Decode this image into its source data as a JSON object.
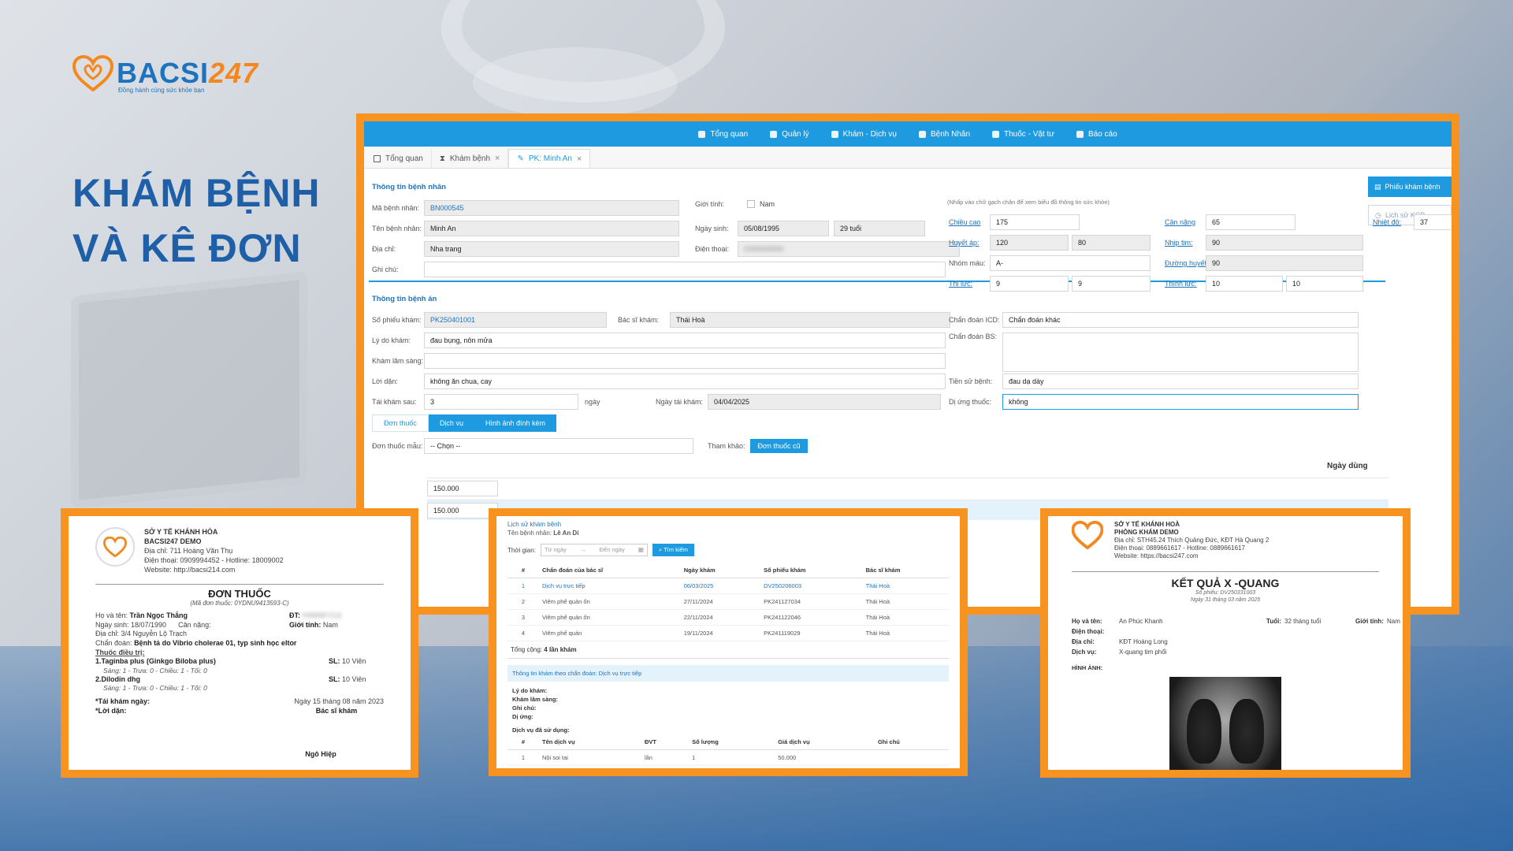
{
  "brand": {
    "name_a": "BACSI",
    "name_b": "247",
    "tagline": "Đồng hành cùng sức khỏe bạn"
  },
  "headline": {
    "line1": "KHÁM BỆNH",
    "line2": "VÀ KÊ ĐƠN"
  },
  "colors": {
    "accent": "#1e9ae0",
    "frame": "#f7931e",
    "title": "#1f5fa8"
  },
  "app": {
    "nav": [
      {
        "label": "Tổng quan",
        "icon": "dashboard-icon"
      },
      {
        "label": "Quản lý",
        "icon": "users-icon"
      },
      {
        "label": "Khám - Dịch vụ",
        "icon": "doctor-icon"
      },
      {
        "label": "Bệnh Nhân",
        "icon": "patient-icon"
      },
      {
        "label": "Thuốc - Vật tư",
        "icon": "medicine-icon"
      },
      {
        "label": "Báo cáo",
        "icon": "report-icon"
      }
    ],
    "tabs": [
      {
        "label": "Tổng quan"
      },
      {
        "label": "Khám bệnh"
      },
      {
        "label": "PK: Minh An"
      }
    ],
    "side": {
      "primary": "Phiếu khám bệnh",
      "secondary": "Lịch sử KCB"
    },
    "patient": {
      "title": "Thông tin bệnh nhân",
      "hint": "(Nhấp vào chữ gạch chân để xem biểu đồ thông tin sức khỏe)",
      "ma_bn_label": "Mã bệnh nhân:",
      "ma_bn": "BN000545",
      "gioi_tinh_label": "Giới tính:",
      "gioi_tinh": "Nam",
      "ten_label": "Tên bệnh nhân:",
      "ten": "Minh An",
      "ngay_sinh_label": "Ngày sinh:",
      "ngay_sinh": "05/08/1995",
      "tuoi": "29 tuổi",
      "dia_chi_label": "Địa chỉ:",
      "dia_chi": "Nha trang",
      "dien_thoai_label": "Điện thoại:",
      "dien_thoai": "0988888888",
      "ghi_chu_label": "Ghi chú:",
      "chieu_cao_label": "Chiều cao",
      "chieu_cao": "175",
      "can_nang_label": "Cân nặng",
      "can_nang": "65",
      "nhiet_do_label": "Nhiệt độ:",
      "nhiet_do": "37",
      "huyet_ap_label": "Huyết áp:",
      "huyet_ap_1": "120",
      "huyet_ap_2": "80",
      "nhip_tim_label": "Nhịp tim:",
      "nhip_tim": "90",
      "nhom_mau_label": "Nhóm máu:",
      "nhom_mau": "A-",
      "duong_huyet_label": "Đường huyết",
      "duong_huyet": "90",
      "thi_luc_label": "Thị lực:",
      "thi_luc_1": "9",
      "thi_luc_2": "9",
      "thinh_luc_label": "Thính lực:",
      "thinh_luc_1": "10",
      "thinh_luc_2": "10"
    },
    "record": {
      "title": "Thông tin bệnh án",
      "so_phieu_label": "Số phiếu khám:",
      "so_phieu": "PK250401001",
      "bac_si_label": "Bác sĩ khám:",
      "bac_si": "Thái Hoà",
      "icd_label": "Chẩn đoán ICD:",
      "icd": "Chẩn đoán khác",
      "ly_do_label": "Lý do khám:",
      "ly_do": "đau bụng, nôn mửa",
      "chan_doan_bs_label": "Chẩn đoán BS:",
      "kham_ls_label": "Khám lâm sàng:",
      "loi_dan_label": "Lời dặn:",
      "loi_dan": "không ăn chua, cay",
      "tien_su_label": "Tiền sử bệnh:",
      "tien_su": "đau dạ dày",
      "tai_kham_label": "Tái khám sau:",
      "tai_kham": "3",
      "tai_kham_unit": "ngày",
      "ngay_tai_kham_label": "Ngày tái khám:",
      "ngay_tai_kham": "04/04/2025",
      "di_ung_label": "Dị ứng thuốc:",
      "di_ung": "không"
    },
    "subtabs": [
      "Đơn thuốc",
      "Dịch vụ",
      "Hình ảnh đính kèm"
    ],
    "don_mau_label": "Đơn thuốc mẫu:",
    "don_mau": "-- Chọn --",
    "tham_khao_label": "Tham khảo:",
    "don_cu_btn": "Đơn thuốc cũ",
    "col_ngay_dung": "Ngày dùng",
    "grid_values": [
      "150.000",
      "150.000"
    ]
  },
  "prescription": {
    "org1": "SỞ Y TẾ KHÁNH HÒA",
    "org2": "BACSI247 DEMO",
    "address": "Địa chỉ: 711 Hoàng Văn Thụ",
    "phone": "Điện thoại: 0909994452 - Hotline: 18009002",
    "website": "Website: http://bacsi214.com",
    "title": "ĐƠN THUỐC",
    "code": "(Mã đơn thuốc: 0YDNU9413593-C)",
    "ho_ten_label": "Họ và tên:",
    "ho_ten": "Trần Ngọc Thắng",
    "dt_label": "ĐT:",
    "dt": "0988887216",
    "ngay_sinh": "Ngày sinh: 18/07/1990",
    "can_nang": "Cân nặng:",
    "gioi_tinh_label": "Giới tính:",
    "gioi_tinh": "Nam",
    "dia_chi": "Địa chỉ: 3/4 Nguyễn Lộ Trạch",
    "chan_doan_label": "Chẩn đoán:",
    "chan_doan": "Bệnh tả do Vibrio cholerae 01, typ sinh học eltor",
    "thuoc_label": "Thuốc điều trị:",
    "drugs": [
      {
        "name": "1.Taginba plus (Ginkgo Biloba plus)",
        "qty_label": "SL:",
        "qty": "10 Viên",
        "dose": "Sáng: 1 - Trưa: 0 - Chiều: 1 - Tối: 0"
      },
      {
        "name": "2.Dilodin dhg",
        "qty_label": "SL:",
        "qty": "10 Viên",
        "dose": "Sáng: 1 - Trưa: 0 - Chiều: 1 - Tối: 0"
      }
    ],
    "tai_kham_label": "*Tái khám ngày:",
    "date": "Ngày 15 tháng 08 năm 2023",
    "loi_dan_label": "*Lời dặn:",
    "bac_si_label": "Bác sĩ khám",
    "signer": "Ngô Hiệp"
  },
  "history": {
    "title": "Lịch sử khám bệnh",
    "patient_label": "Tên bệnh nhân:",
    "patient": "Lê An Di",
    "time_label": "Thời gian:",
    "from_ph": "Từ ngày",
    "to_ph": "Đến ngày",
    "search_btn": "Tìm kiếm",
    "columns": [
      "#",
      "Chẩn đoán của bác sĩ",
      "Ngày khám",
      "Số phiếu khám",
      "Bác sĩ khám"
    ],
    "rows": [
      {
        "n": "1",
        "dx": "Dịch vụ trực tiếp",
        "date": "06/03/2025",
        "code": "DV250206003",
        "doc": "Thái Hoà"
      },
      {
        "n": "2",
        "dx": "Viêm phế quản ốn",
        "date": "27/11/2024",
        "code": "PK241127034",
        "doc": "Thái Hoà"
      },
      {
        "n": "3",
        "dx": "Viêm phế quản ốn",
        "date": "22/11/2024",
        "code": "PK241122046",
        "doc": "Thái Hoà"
      },
      {
        "n": "4",
        "dx": "Viêm phế quản",
        "date": "19/11/2024",
        "code": "PK241119029",
        "doc": "Thái Hoà"
      }
    ],
    "total_label": "Tổng cộng:",
    "total": "4 lần khám",
    "band": "Thông tin khám theo chẩn đoán: Dịch vụ trực tiếp",
    "kv": [
      "Lý do khám:",
      "Khám lâm sàng:",
      "Ghi chú:",
      "Dị ứng:"
    ],
    "dv_label": "Dịch vụ đã sử dụng:",
    "dv_columns": [
      "#",
      "Tên dịch vụ",
      "ĐVT",
      "Số lượng",
      "Giá dịch vụ",
      "Ghi chú"
    ],
    "dv_rows": [
      {
        "n": "1",
        "name": "Nội soi tai",
        "unit": "lần",
        "qty": "1",
        "price": "50.000",
        "note": ""
      }
    ]
  },
  "xray": {
    "org1": "SỞ Y TẾ KHÁNH HOÀ",
    "org2": "PHÒNG KHÁM DEMO",
    "address": "Địa chỉ: STH45.24 Thích Quảng Đức, KĐT Hà Quang 2",
    "phone": "Điện thoại: 0889661617 - Hotline: 0889661617",
    "website": "Website: https://bacsi247.com",
    "title": "KẾT QUẢ X -QUANG",
    "code": "Số phiếu: DV250331003",
    "date": "Ngày 31 tháng 03 năm 2025",
    "ho_ten_label": "Họ và tên:",
    "ho_ten": "An Phúc Khanh",
    "tuoi_label": "Tuổi:",
    "tuoi": "32 tháng tuổi",
    "gioi_tinh_label": "Giới tính:",
    "gioi_tinh": "Nam",
    "dien_thoai_label": "Điện thoại:",
    "dia_chi_label": "Địa chỉ:",
    "dia_chi": "KĐT Hoàng Long",
    "dich_vu_label": "Dịch vụ:",
    "dich_vu": "X-quang tim phổi",
    "hinh_anh_label": "HÌNH ẢNH:"
  }
}
